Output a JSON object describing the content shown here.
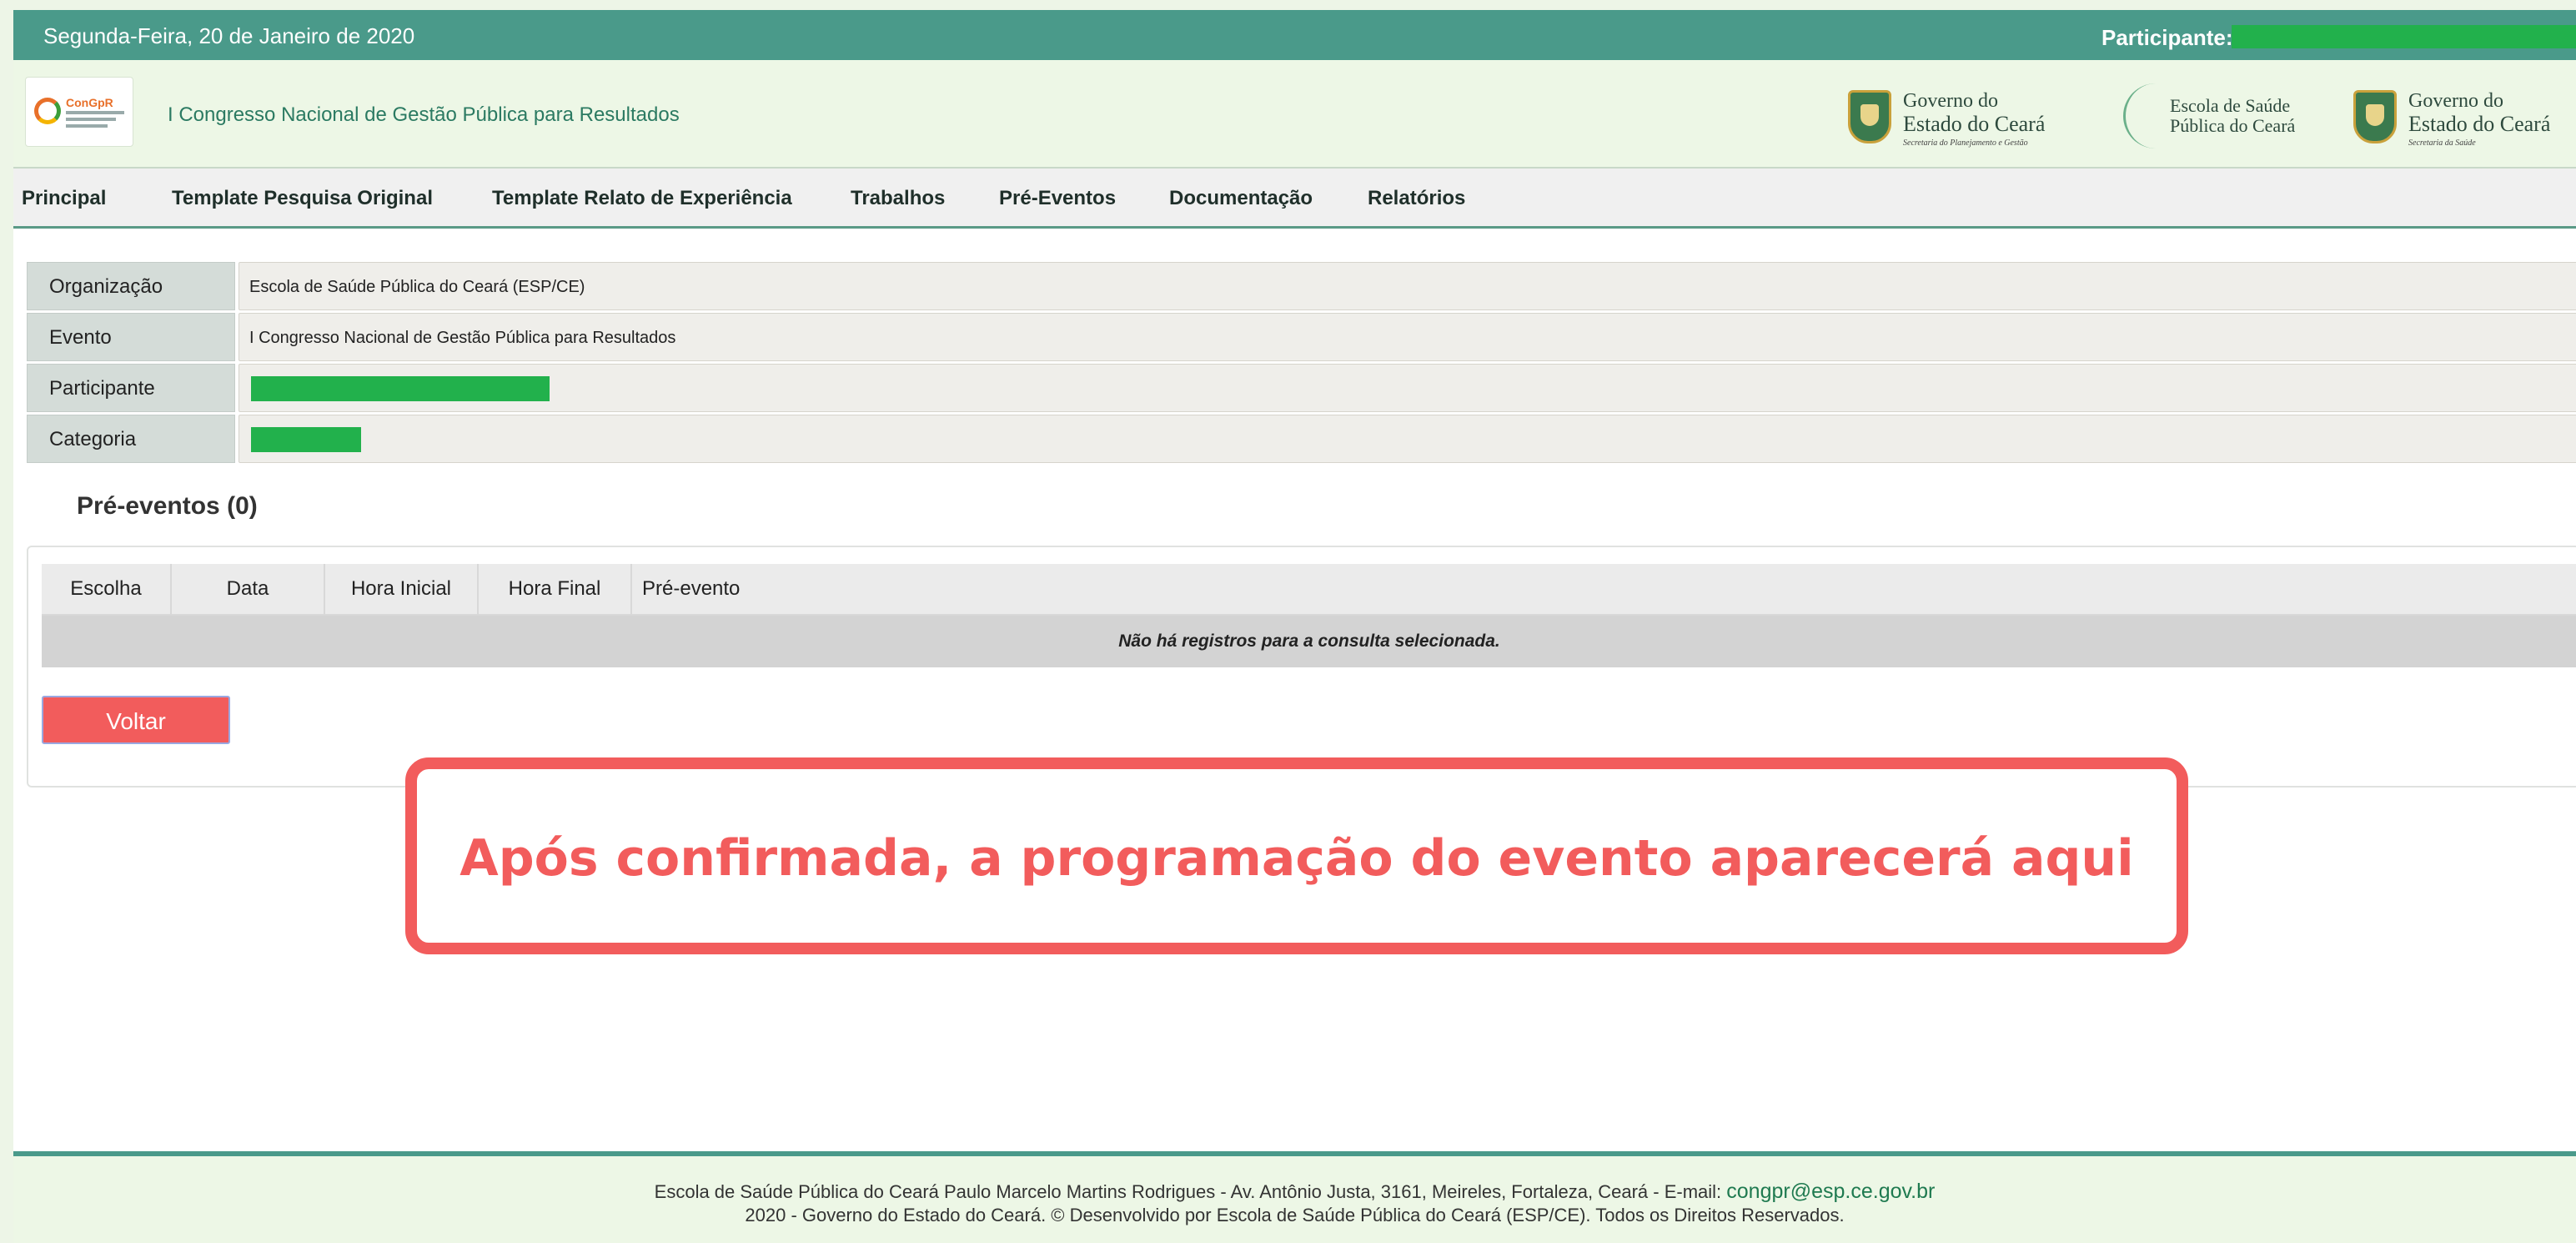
{
  "topbar": {
    "date": "Segunda-Feira, 20 de Janeiro de 2020",
    "participant_label": "Participante:"
  },
  "header": {
    "logo_text": "ConGpR",
    "site_title": "I Congresso Nacional de Gestão Pública para Resultados",
    "partners": [
      {
        "line1": "Governo do",
        "line2": "Estado do Ceará",
        "line3": "Secretaria do Planejamento e Gestão"
      },
      {
        "line1": "Escola de Saúde",
        "line2": "Pública do Ceará"
      },
      {
        "line1": "Governo do",
        "line2": "Estado do Ceará",
        "line3": "Secretaria da Saúde"
      }
    ]
  },
  "menu": [
    "Principal",
    "Template Pesquisa Original",
    "Template Relato de Experiência",
    "Trabalhos",
    "Pré-Eventos",
    "Documentação",
    "Relatórios"
  ],
  "info": {
    "organizacao_label": "Organização",
    "organizacao_value": "Escola de Saúde Pública do Ceará (ESP/CE)",
    "evento_label": "Evento",
    "evento_value": "I Congresso Nacional de Gestão Pública para Resultados",
    "participante_label": "Participante",
    "categoria_label": "Categoria"
  },
  "pre_eventos": {
    "title": "Pré-eventos (0)",
    "columns": [
      "Escolha",
      "Data",
      "Hora Inicial",
      "Hora Final",
      "Pré-evento"
    ],
    "empty_message": "Não há registros para a consulta selecionada.",
    "back_label": "Voltar"
  },
  "callout": {
    "text": "Após confirmada, a programação do evento aparecerá aqui"
  },
  "footer": {
    "line1": "Escola de Saúde Pública do Ceará Paulo Marcelo Martins Rodrigues - Av. Antônio Justa, 3161, Meireles, Fortaleza, Ceará - E-mail: ",
    "email": "congpr@esp.ce.gov.br",
    "line2": "2020 - Governo do Estado do Ceará. © Desenvolvido por Escola de Saúde Pública do Ceará (ESP/CE). Todos os Direitos Reservados."
  },
  "colors": {
    "topbar": "#4a9a8a",
    "accent_red": "#f25c5c",
    "redaction_green": "#22b14c"
  }
}
